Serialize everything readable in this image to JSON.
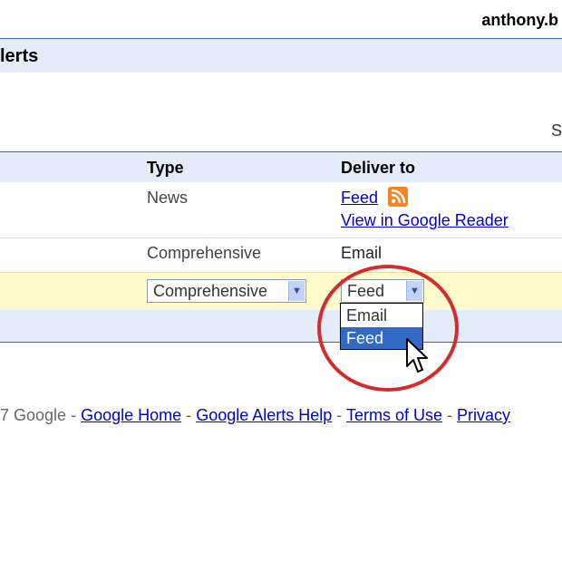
{
  "header": {
    "user_email": "anthony.b",
    "title": "lerts",
    "edge_char": "S"
  },
  "table": {
    "columns": {
      "type": "Type",
      "deliver_to": "Deliver to"
    },
    "row1": {
      "type": "News",
      "deliver_link": "Feed",
      "reader_link": "View in Google Reader"
    },
    "row2": {
      "type": "Comprehensive",
      "deliver": "Email"
    },
    "edit_row": {
      "type_select": "Comprehensive",
      "deliver_select": "Feed"
    }
  },
  "dropdown": {
    "options": [
      "Email",
      "Feed"
    ],
    "selected": "Feed"
  },
  "annotation": {
    "circle_color": "#d22c2c"
  },
  "footer": {
    "copyright": "7 Google",
    "dash": "-",
    "links": [
      "Google Home",
      "Google Alerts Help",
      "Terms of Use",
      "Privacy"
    ]
  },
  "colors": {
    "header_bg": "#e5ecf9",
    "edit_row_bg": "#fffbcc",
    "link": "#0000cc",
    "selected_option": "#316ac5"
  }
}
